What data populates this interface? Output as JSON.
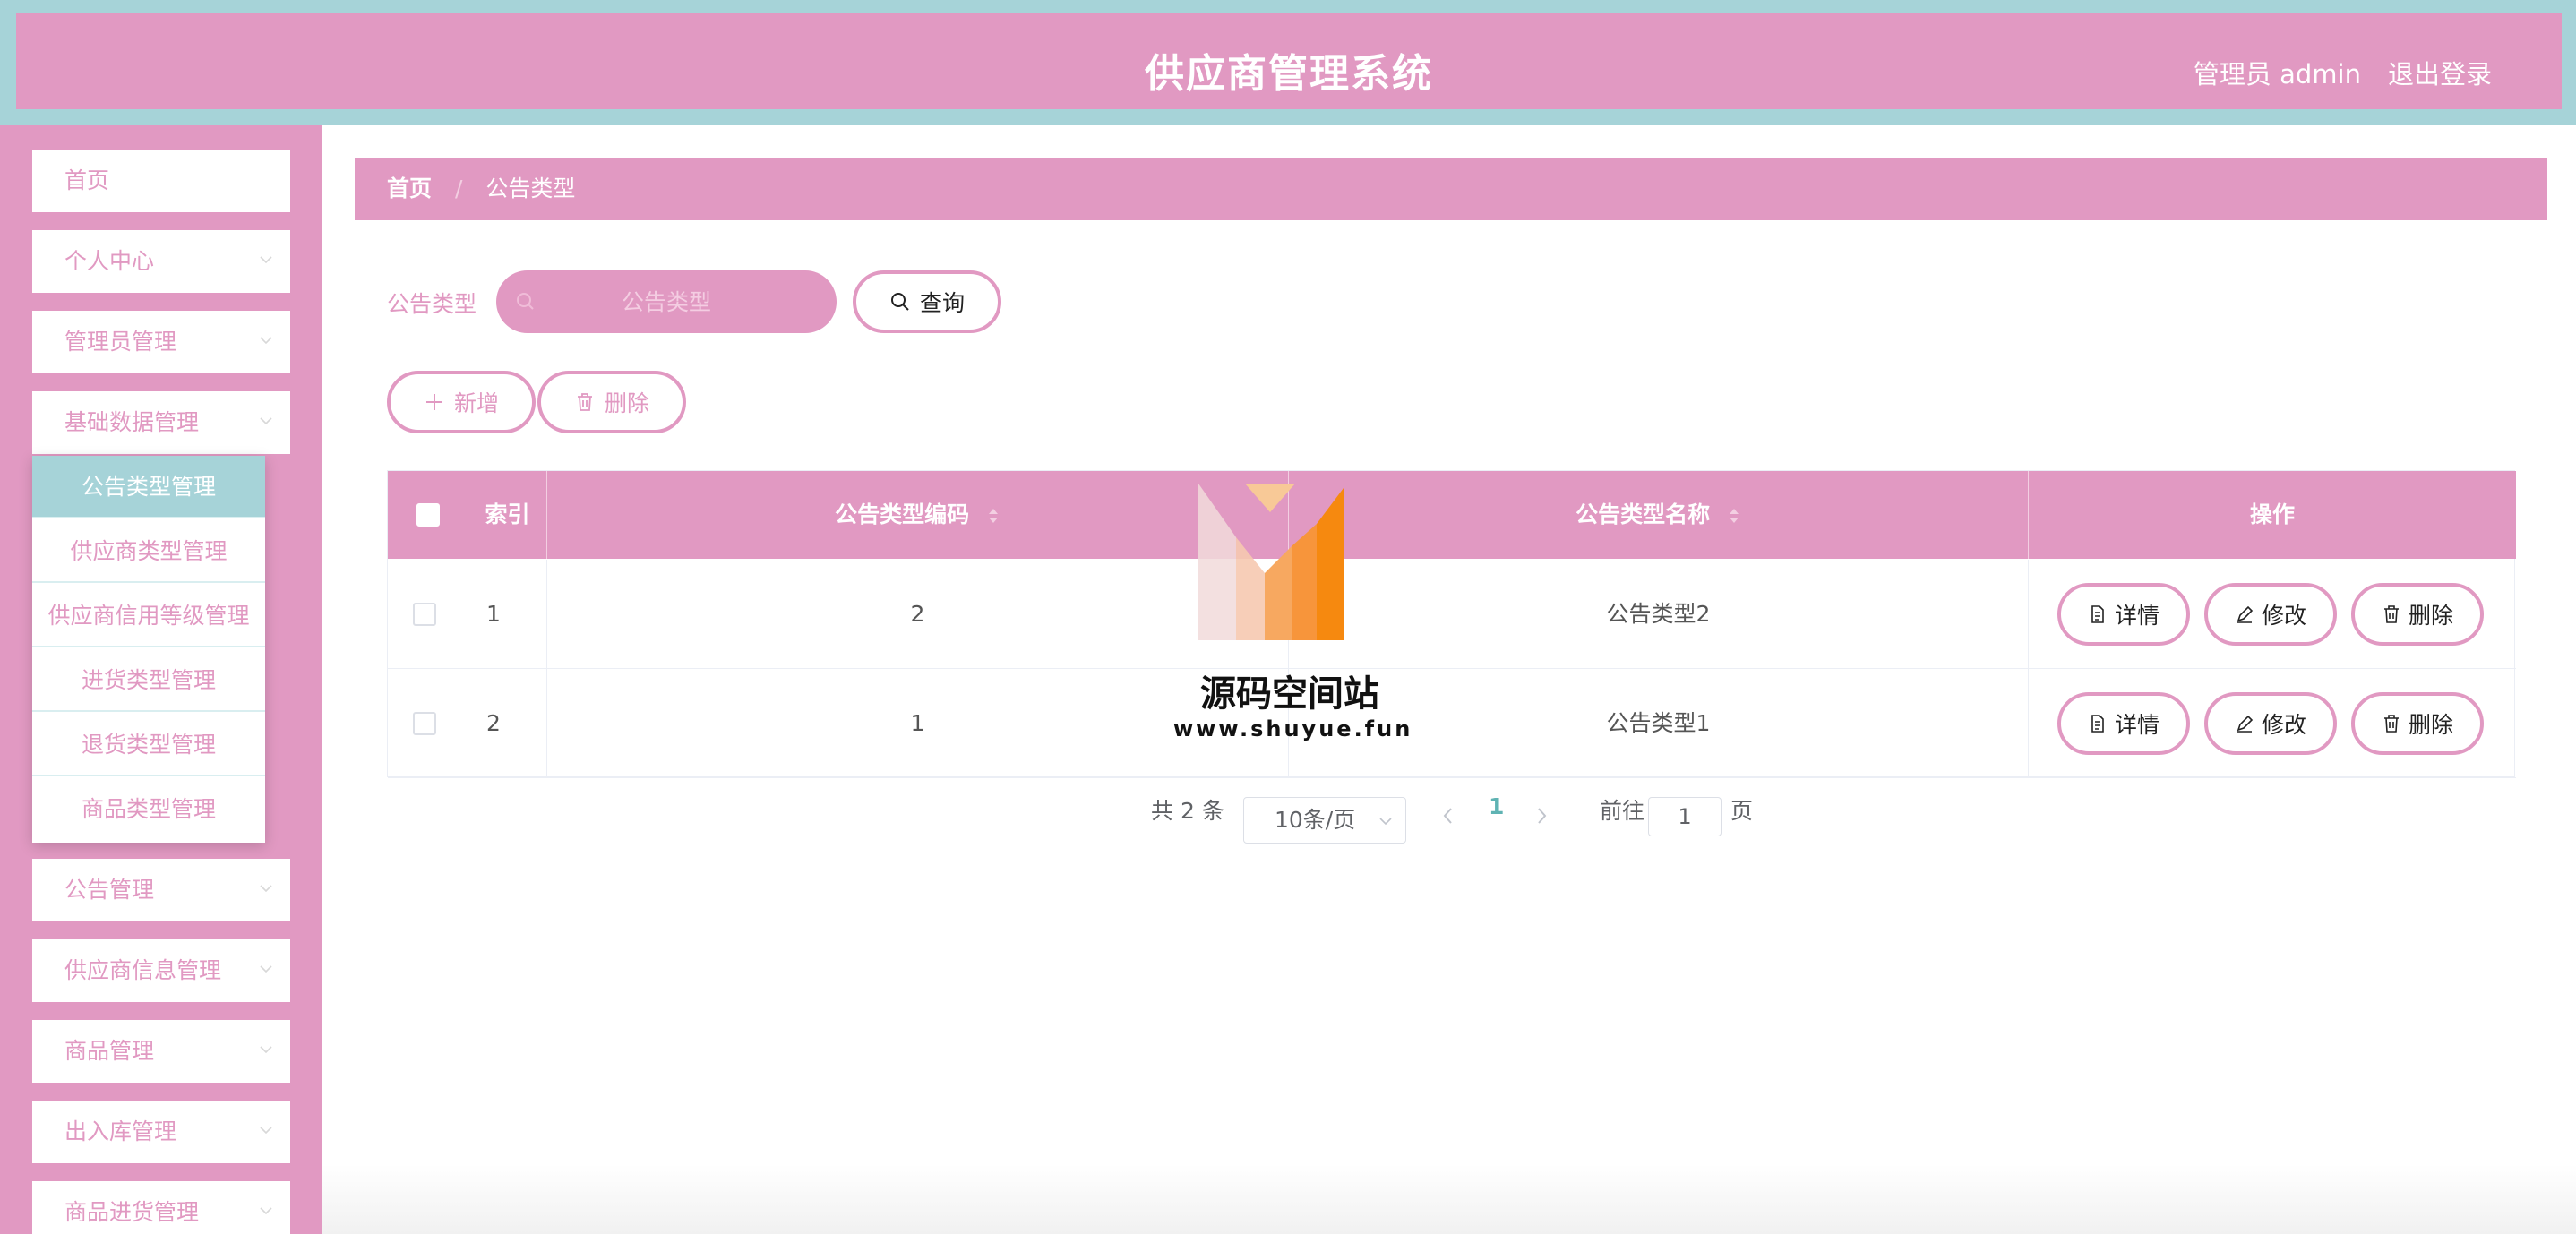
{
  "header": {
    "title": "供应商管理系统",
    "user": "管理员 admin",
    "logout": "退出登录"
  },
  "sidebar": {
    "items": [
      {
        "label": "首页",
        "has_chevron": false
      },
      {
        "label": "个人中心",
        "has_chevron": true
      },
      {
        "label": "管理员管理",
        "has_chevron": true
      },
      {
        "label": "基础数据管理",
        "has_chevron": true
      },
      {
        "label": "公告管理",
        "has_chevron": true
      },
      {
        "label": "供应商信息管理",
        "has_chevron": true
      },
      {
        "label": "商品管理",
        "has_chevron": true
      },
      {
        "label": "出入库管理",
        "has_chevron": true
      },
      {
        "label": "商品进货管理",
        "has_chevron": true
      }
    ],
    "submenu": [
      {
        "label": "公告类型管理",
        "active": true
      },
      {
        "label": "供应商类型管理",
        "active": false
      },
      {
        "label": "供应商信用等级管理",
        "active": false
      },
      {
        "label": "进货类型管理",
        "active": false
      },
      {
        "label": "退货类型管理",
        "active": false
      },
      {
        "label": "商品类型管理",
        "active": false
      }
    ]
  },
  "breadcrumb": {
    "home": "首页",
    "separator": "/",
    "current": "公告类型"
  },
  "search": {
    "label": "公告类型",
    "placeholder": "公告类型",
    "button": "查询"
  },
  "actions": {
    "add": "新增",
    "delete": "删除"
  },
  "table": {
    "columns": [
      "索引",
      "公告类型编码",
      "公告类型名称",
      "操作"
    ],
    "rows": [
      {
        "index": "1",
        "code": "2",
        "name": "公告类型2"
      },
      {
        "index": "2",
        "code": "1",
        "name": "公告类型1"
      }
    ],
    "row_actions": {
      "detail": "详情",
      "edit": "修改",
      "delete": "删除"
    }
  },
  "pagination": {
    "total": "共 2 条",
    "page_size": "10条/页",
    "current_page": "1",
    "goto_label": "前往",
    "goto_value": "1",
    "page_suffix": "页"
  },
  "watermark": {
    "title": "源码空间站",
    "url": "www.shuyue.fun"
  },
  "colors": {
    "primary_pink": "#e199c2",
    "teal": "#a6d3d8",
    "white": "#ffffff"
  }
}
